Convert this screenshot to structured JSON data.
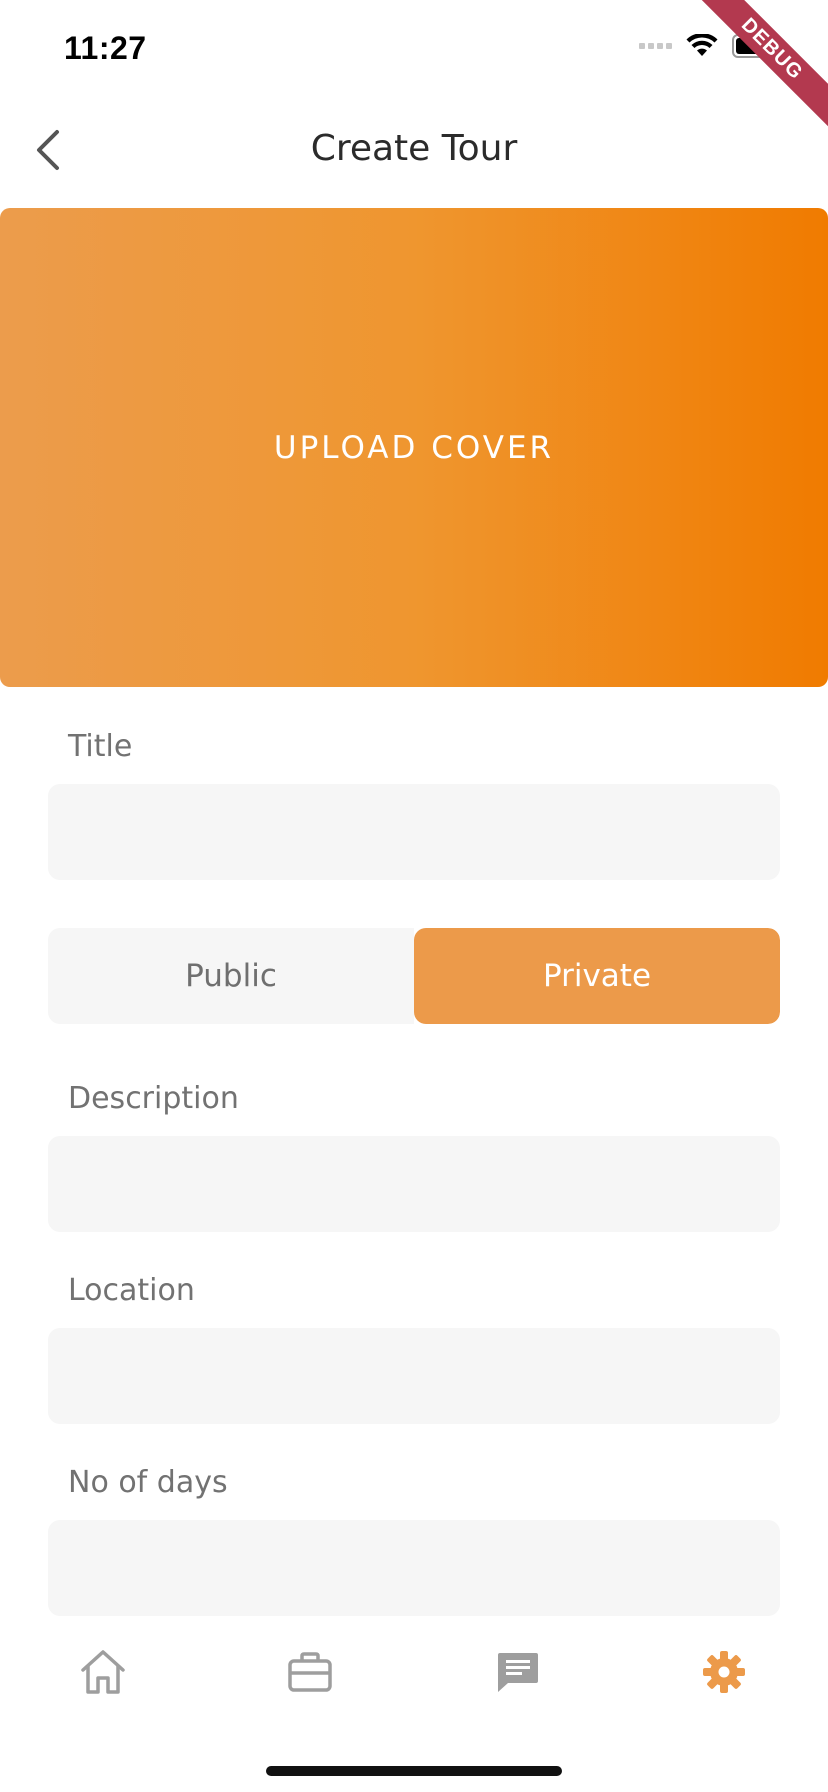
{
  "status_bar": {
    "time": "11:27",
    "icons": [
      "signal-icon",
      "wifi-icon",
      "battery-icon"
    ]
  },
  "debug_banner": "DEBUG",
  "header": {
    "back_icon": "chevron-left-icon",
    "title": "Create Tour"
  },
  "cover": {
    "label": "UPLOAD COVER",
    "gradient": [
      "#ec9c4c",
      "#f07b00"
    ]
  },
  "form": {
    "title_label": "Title",
    "title_value": "",
    "visibility": {
      "options": [
        "Public",
        "Private"
      ],
      "selected": "Private"
    },
    "description_label": "Description",
    "description_value": "",
    "location_label": "Location",
    "location_value": "",
    "days_label": "No of days",
    "days_value": ""
  },
  "bottom_nav": {
    "items": [
      {
        "icon": "home-icon",
        "active": false
      },
      {
        "icon": "briefcase-icon",
        "active": false
      },
      {
        "icon": "chat-icon",
        "active": false
      },
      {
        "icon": "gear-icon",
        "active": true
      }
    ]
  },
  "colors": {
    "accent": "#ec9a4a",
    "inactive_icon": "#9e9e9e",
    "field_bg": "#f6f6f6"
  }
}
